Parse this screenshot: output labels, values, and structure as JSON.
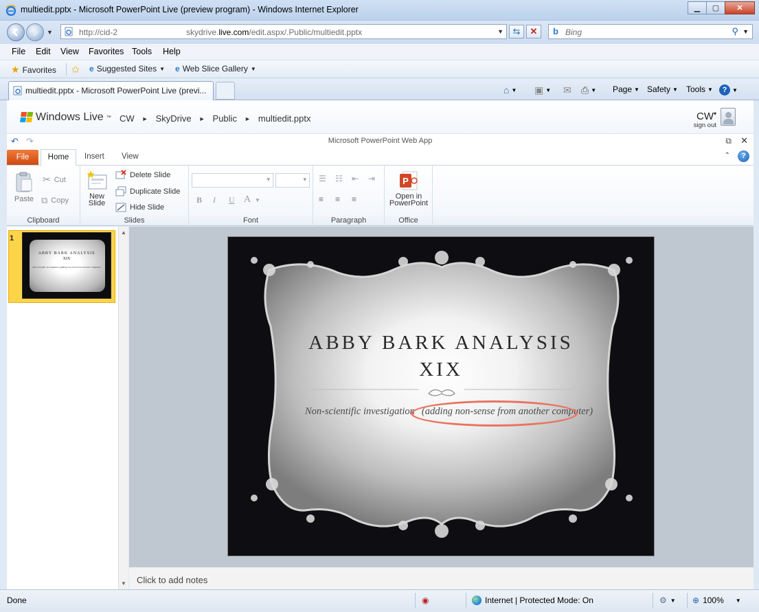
{
  "window": {
    "title": "multiedit.pptx - Microsoft PowerPoint Live (preview program) - Windows Internet Explorer",
    "controls": [
      "minimize",
      "maximize",
      "close"
    ]
  },
  "navigation": {
    "address_prefix": "http://cid-2",
    "address_domain_pre": "skydrive.",
    "address_domain_bold": "live.com",
    "address_path": "/edit.aspx/.Public/multiedit.pptx",
    "search_placeholder": "Bing"
  },
  "menu": [
    "File",
    "Edit",
    "View",
    "Favorites",
    "Tools",
    "Help"
  ],
  "favorites_bar": {
    "favorites": "Favorites",
    "suggested_sites": "Suggested Sites",
    "web_slice_gallery": "Web Slice Gallery"
  },
  "tabs": {
    "active_label": "multiedit.pptx - Microsoft PowerPoint Live (previ..."
  },
  "command_bar": {
    "page": "Page",
    "safety": "Safety",
    "tools": "Tools"
  },
  "windows_live": {
    "brand": "Windows Live",
    "breadcrumb": [
      "CW",
      "SkyDrive",
      "Public",
      "multiedit.pptx"
    ],
    "user_initials": "CW",
    "sign_out": "sign out"
  },
  "app": {
    "title": "Microsoft PowerPoint Web App"
  },
  "ribbon": {
    "tabs": {
      "file": "File",
      "home": "Home",
      "insert": "Insert",
      "view": "View"
    },
    "clipboard": {
      "paste": "Paste",
      "cut": "Cut",
      "copy": "Copy",
      "label": "Clipboard"
    },
    "slides": {
      "new_slide_1": "New",
      "new_slide_2": "Slide",
      "delete": "Delete Slide",
      "duplicate": "Duplicate Slide",
      "hide": "Hide Slide",
      "label": "Slides"
    },
    "font": {
      "label": "Font",
      "bold": "B",
      "italic": "I",
      "underline": "U",
      "color": "A"
    },
    "paragraph": {
      "label": "Paragraph"
    },
    "office": {
      "open_1": "Open in",
      "open_2": "PowerPoint",
      "label": "Office"
    }
  },
  "thumbnails": [
    {
      "number": "1",
      "title_1": "ABBY BARK ANALYSIS",
      "title_2": "XIX",
      "subtitle": "Non-scientific investigation (adding non-sense from another computer)"
    }
  ],
  "slide": {
    "title_line_1": "ABBY BARK ANALYSIS",
    "title_line_2": "XIX",
    "subtitle_part_1": "Non-scientific investigation",
    "subtitle_part_2": "(adding non-sense from another computer)",
    "highlight_color": "#e8735f"
  },
  "notes": {
    "placeholder": "Click to add notes"
  },
  "status": {
    "left": "Done",
    "zone": "Internet | Protected Mode: On",
    "zoom": "100%"
  },
  "colors": {
    "file_tab": "#e0601f",
    "selected_thumbnail": "#fbd44a",
    "slide_background": "#0e0e12"
  }
}
